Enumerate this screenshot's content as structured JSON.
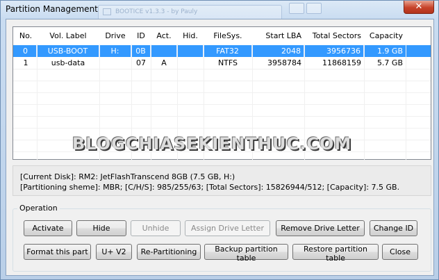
{
  "window": {
    "title": "Partition Management",
    "close_glyph": "✕"
  },
  "background_tab": {
    "label": "BOOTICE v1.3.3 - by Pauly"
  },
  "columns": [
    "No.",
    "Vol. Label",
    "Drive",
    "ID",
    "Act.",
    "Hid.",
    "FileSys.",
    "Start LBA",
    "Total Sectors",
    "Capacity"
  ],
  "rows": [
    {
      "no": "0",
      "label": "USB-BOOT",
      "drive": "H:",
      "id": "0B",
      "act": "",
      "hid": "",
      "fs": "FAT32",
      "start": "2048",
      "total": "3956736",
      "cap": "1.9 GB",
      "selected": true
    },
    {
      "no": "1",
      "label": "usb-data",
      "drive": "",
      "id": "07",
      "act": "A",
      "hid": "",
      "fs": "NTFS",
      "start": "3958784",
      "total": "11868159",
      "cap": "5.7 GB",
      "selected": false
    }
  ],
  "disk_info": {
    "line1": "[Current Disk]:   RM2: JetFlashTranscend 8GB (7.5 GB, H:)",
    "line2": "[Partitioning sheme]:     MBR;      [C/H/S]: 985/255/63;  [Total Sectors]: 15826944/512;  [Capacity]: 7.5 GB."
  },
  "operation": {
    "label": "Operation",
    "activate": "Activate",
    "hide": "Hide",
    "unhide": "Unhide",
    "assign": "Assign Drive Letter",
    "remove": "Remove Drive Letter",
    "change_id": "Change ID",
    "format": "Format this part",
    "uv2": "U+ V2",
    "repartition": "Re-Partitioning",
    "backup": "Backup partition table",
    "restore": "Restore partition table",
    "close": "Close"
  },
  "watermark": "BLOGCHIASEKIENTHUC.COM",
  "colors": {
    "selection": "#3399ff",
    "title_bar": "#c9dcf1",
    "close_button": "#c7432a"
  }
}
